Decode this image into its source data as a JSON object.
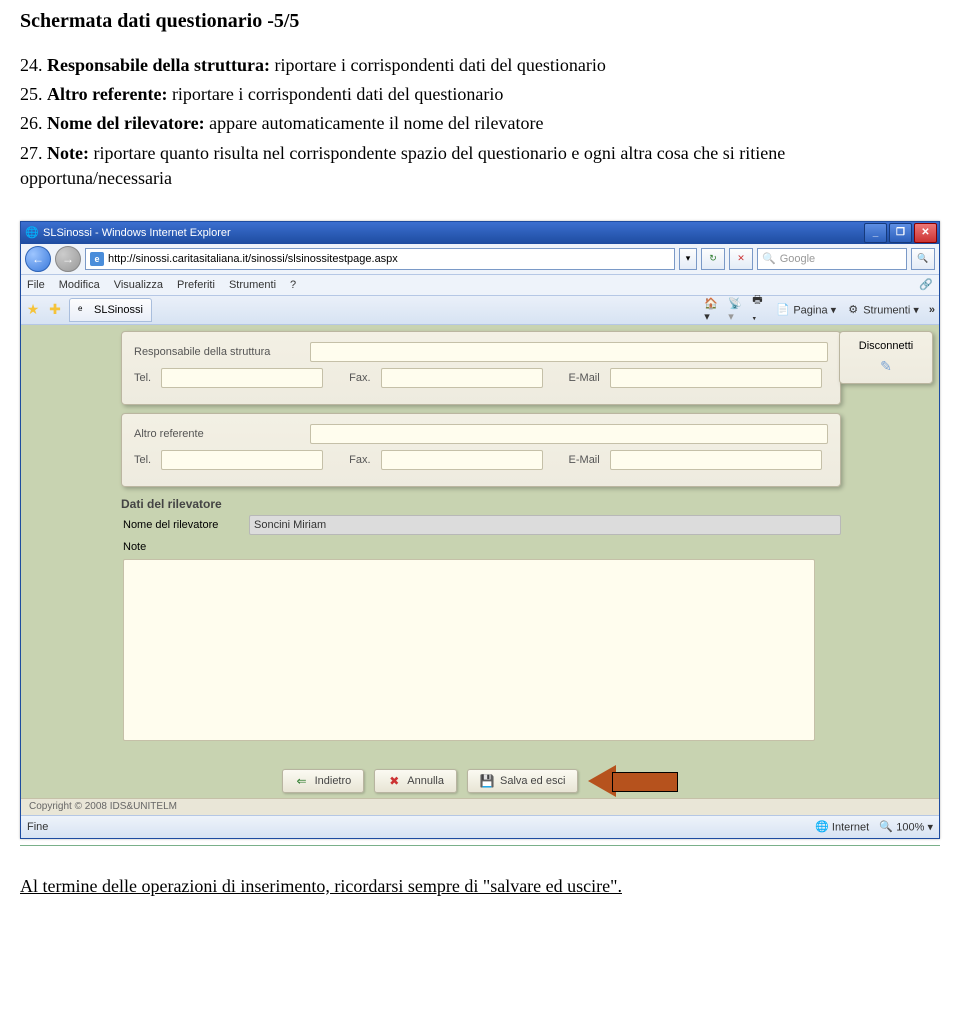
{
  "doc": {
    "title": "Schermata dati questionario -5/5",
    "items": [
      {
        "num": "24.",
        "label": "Responsabile della struttura:",
        "text": " riportare i corrispondenti dati del questionario"
      },
      {
        "num": "25.",
        "label": "Altro referente:",
        "text": " riportare i corrispondenti dati del questionario"
      },
      {
        "num": "26.",
        "label": "Nome del rilevatore:",
        "text": " appare automaticamente il nome del rilevatore"
      },
      {
        "num": "27.",
        "label": "Note:",
        "text": " riportare quanto risulta nel corrispondente spazio del questionario e ogni altra cosa che si ritiene opportuna/necessaria"
      }
    ],
    "footer": "Al termine delle operazioni di inserimento, ricordarsi sempre di \"salvare ed uscire\"."
  },
  "browser": {
    "title": "SLSinossi - Windows Internet Explorer",
    "url": "http://sinossi.caritasitaliana.it/sinossi/slsinossitestpage.aspx",
    "search_placeholder": "Google",
    "menus": [
      "File",
      "Modifica",
      "Visualizza",
      "Preferiti",
      "Strumenti",
      "?"
    ],
    "tab_label": "SLSinossi",
    "toolbar_right": {
      "pagina": "Pagina",
      "strumenti": "Strumenti"
    },
    "overflow": "»",
    "status_left": "Fine",
    "status_internet": "Internet",
    "status_zoom": "100%"
  },
  "form": {
    "responsabile_label": "Responsabile della struttura",
    "tel_label": "Tel.",
    "fax_label": "Fax.",
    "email_label": "E-Mail",
    "altro_label": "Altro referente",
    "section_title": "Dati del rilevatore",
    "nome_label": "Nome del rilevatore",
    "nome_value": "Soncini Miriam",
    "note_label": "Note",
    "btn_indietro": "Indietro",
    "btn_annulla": "Annulla",
    "btn_salva": "Salva ed esci",
    "disconnect": "Disconnetti",
    "copyright": "Copyright © 2008 IDS&UNITELM"
  }
}
